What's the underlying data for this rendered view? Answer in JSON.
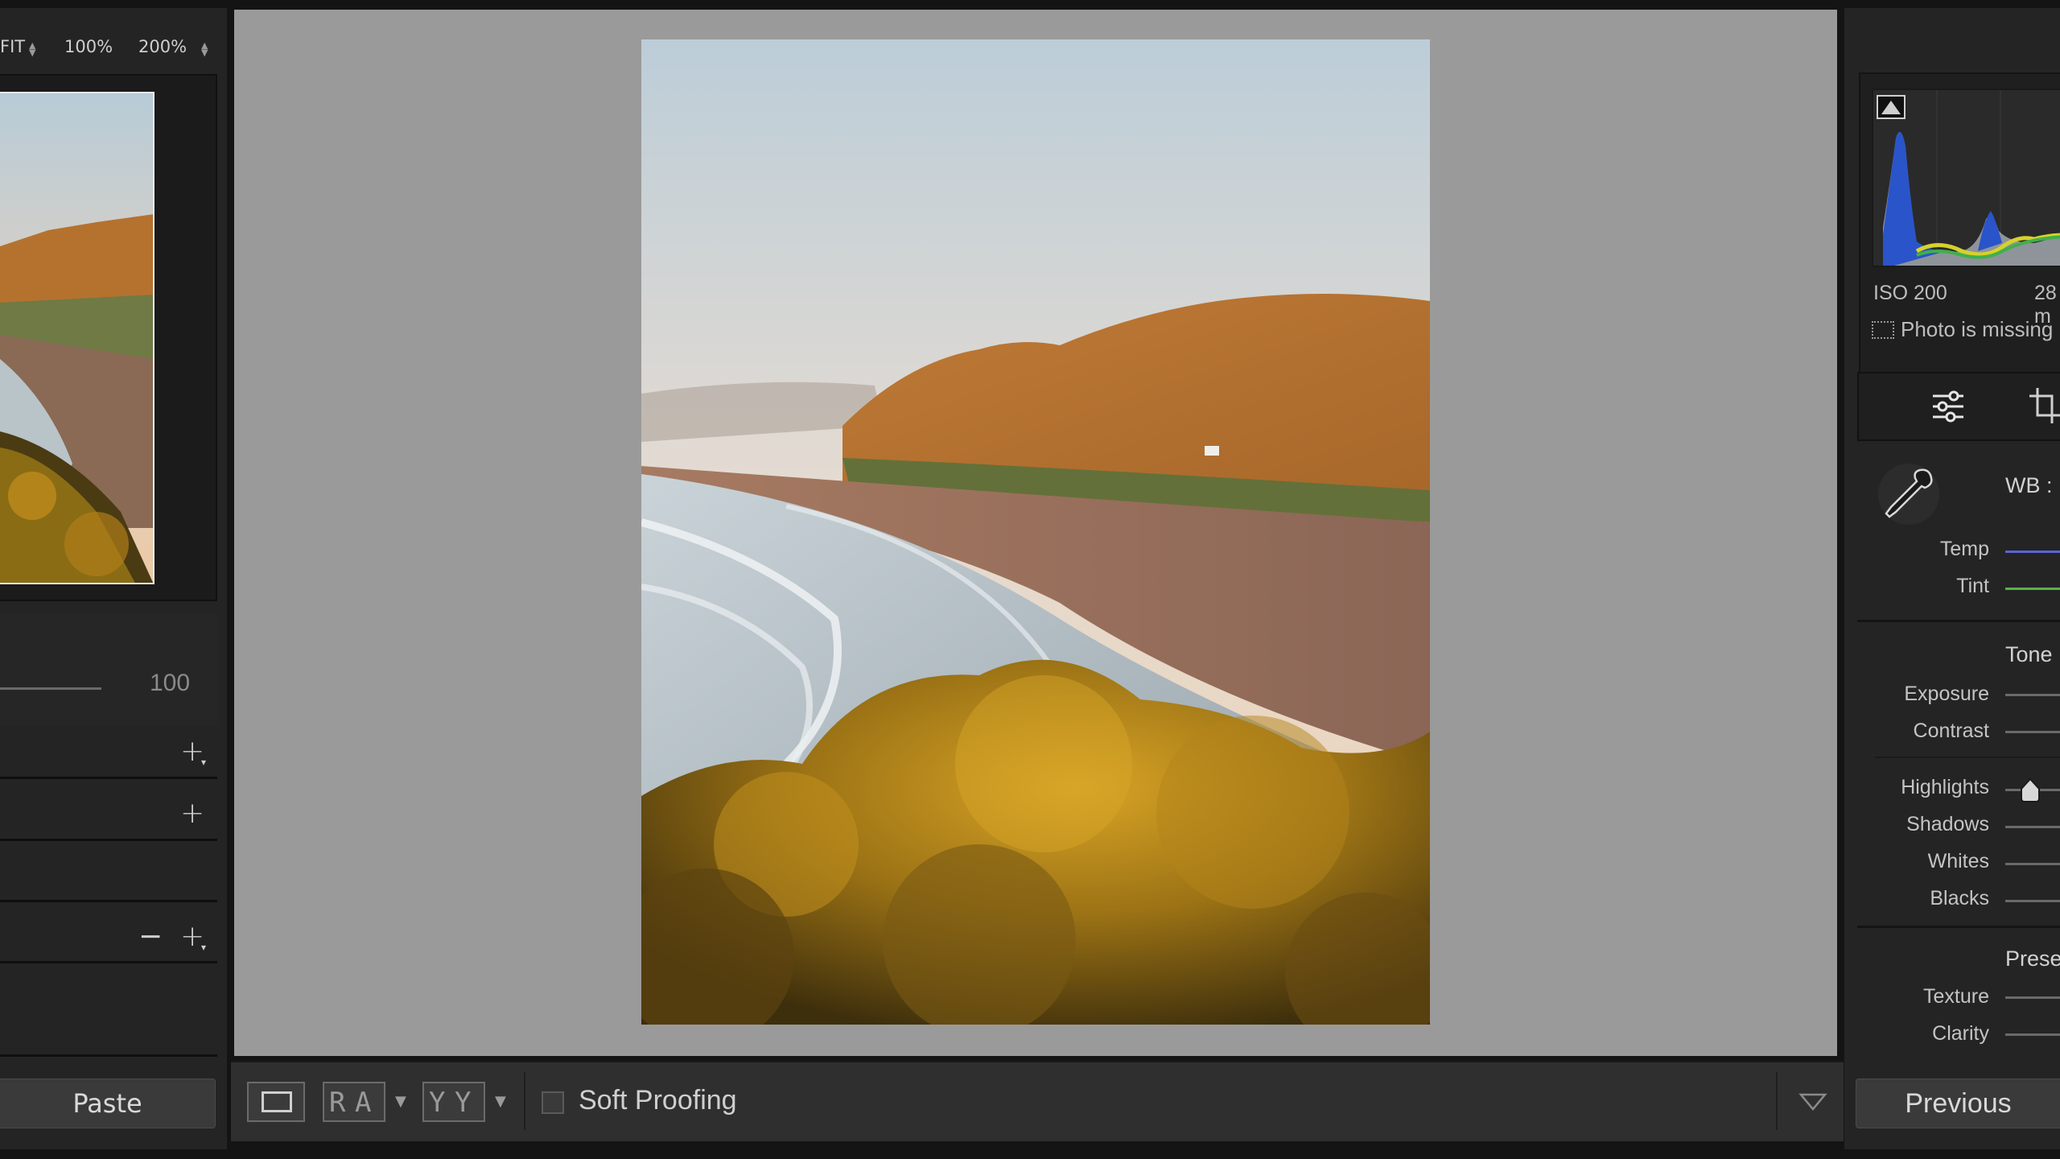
{
  "navigator": {
    "zoom_fit": "FIT",
    "zoom_100": "100%",
    "zoom_200": "200%"
  },
  "left_panel": {
    "value_100": "100",
    "paste_label": "Paste"
  },
  "toolbar": {
    "soft_proofing_label": "Soft Proofing",
    "soft_proofing_checked": false
  },
  "histogram": {
    "iso": "ISO 200",
    "focal_partial": "28 m",
    "photo_missing": "Photo is missing"
  },
  "basic": {
    "wb_label": "WB :",
    "temp_label": "Temp",
    "tint_label": "Tint",
    "tone_label": "Tone",
    "exposure_label": "Exposure",
    "contrast_label": "Contrast",
    "highlights_label": "Highlights",
    "shadows_label": "Shadows",
    "whites_label": "Whites",
    "blacks_label": "Blacks",
    "presence_partial": "Prese",
    "texture_label": "Texture",
    "clarity_label": "Clarity"
  },
  "right_panel": {
    "previous_label": "Previous"
  },
  "colors": {
    "temp_track": "#5b63d6",
    "tint_track": "#5ab24a",
    "panel_bg": "#242424",
    "canvas_bg": "#9a9a9a"
  }
}
